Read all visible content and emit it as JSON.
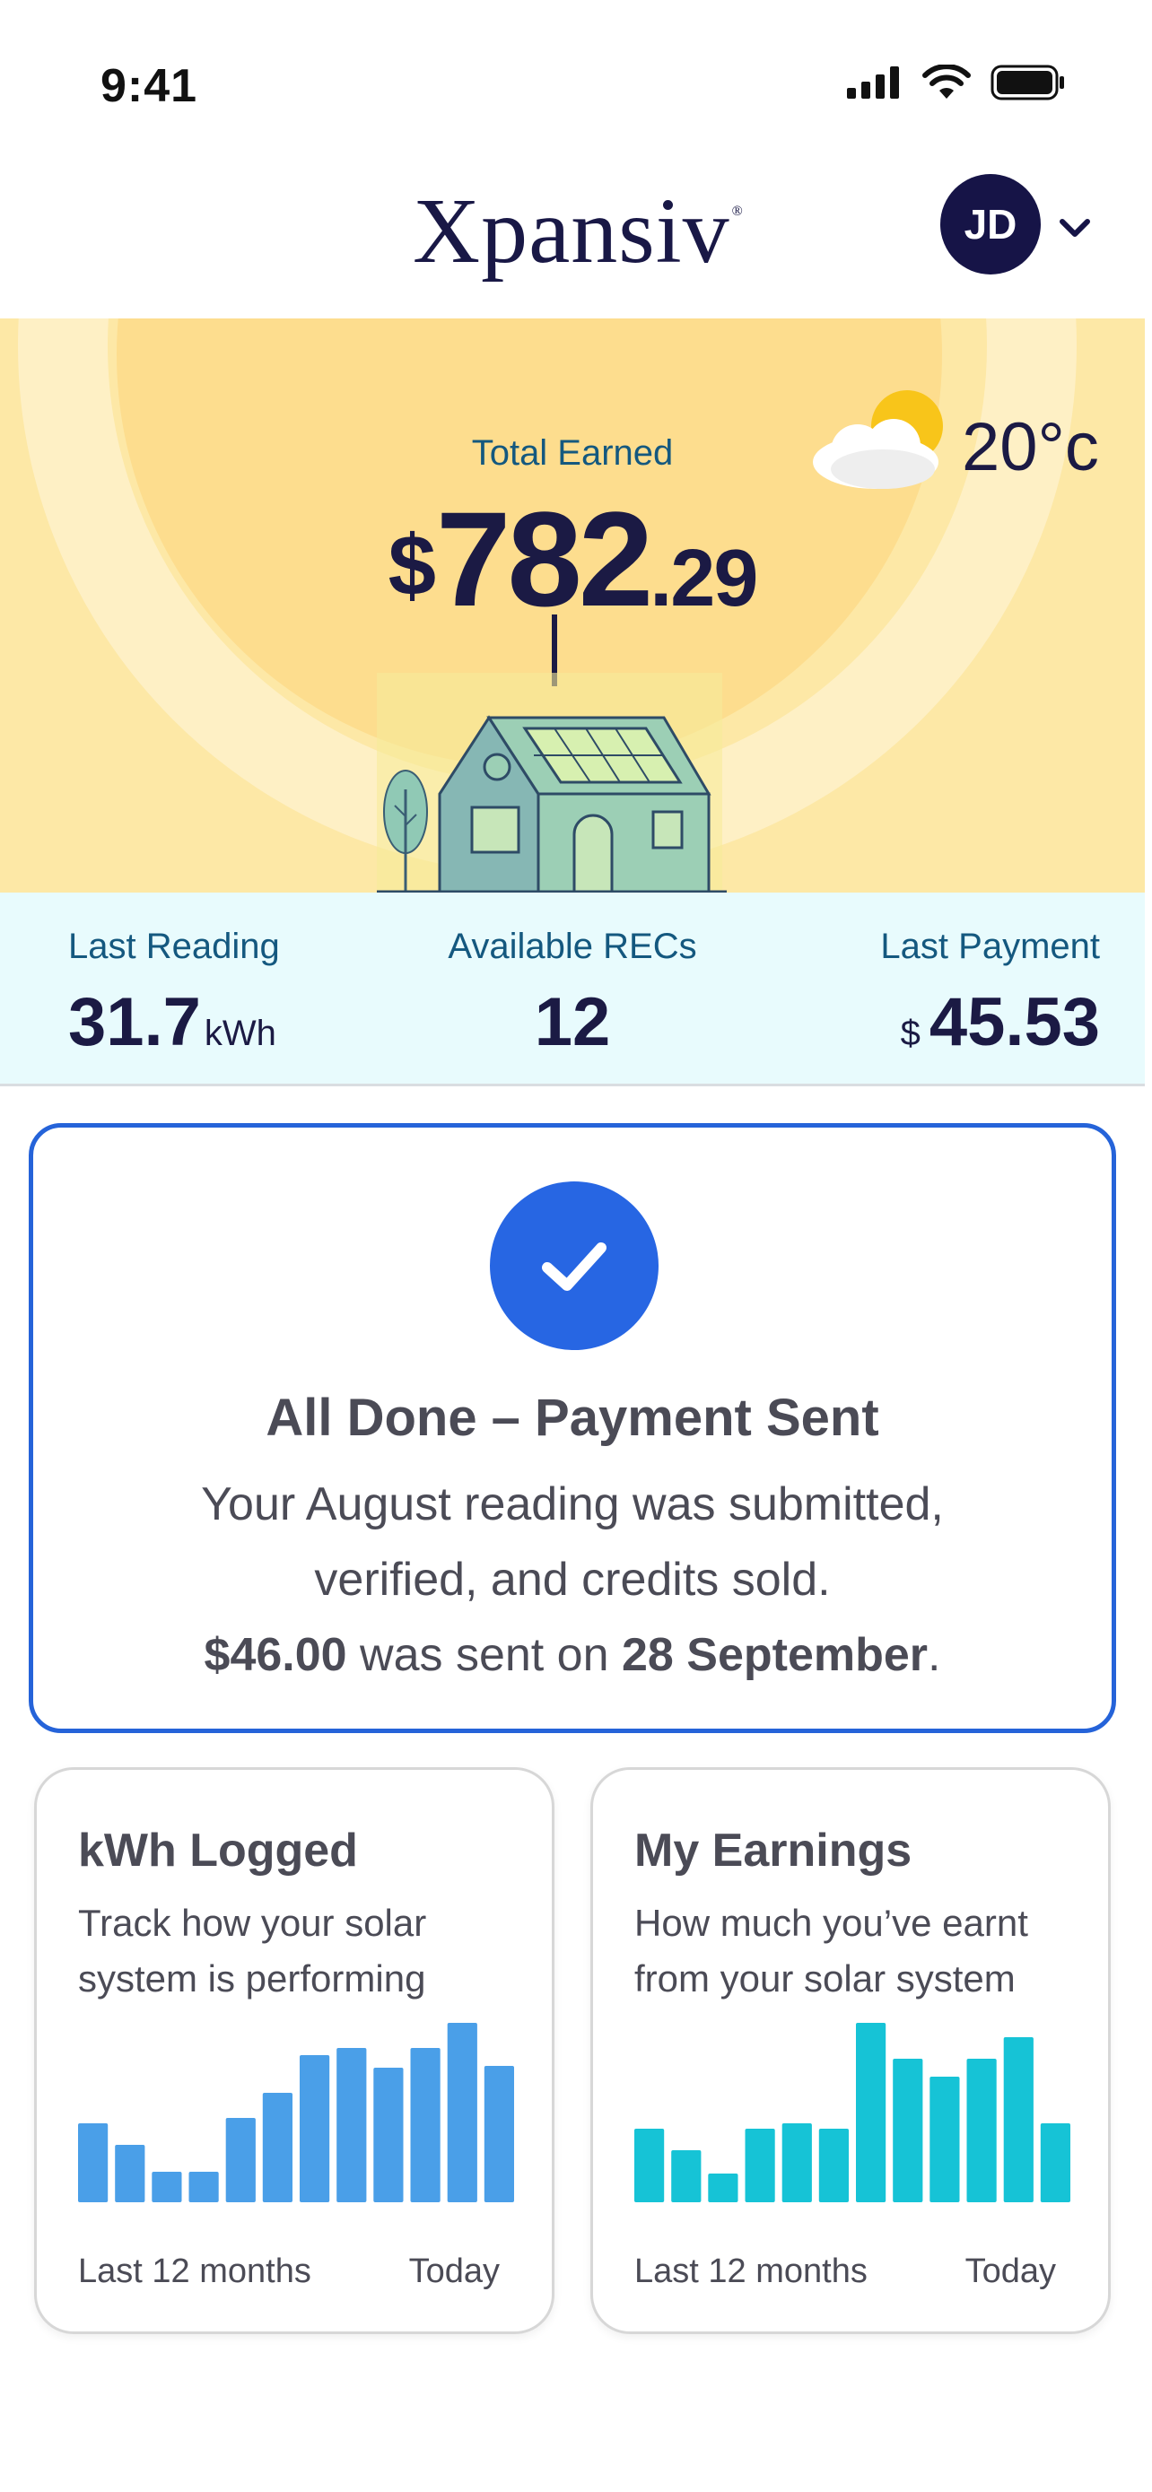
{
  "status_bar": {
    "time": "9:41"
  },
  "header": {
    "logo": "Xpansiv",
    "logo_mark": "®",
    "avatar_initials": "JD"
  },
  "hero": {
    "total_label": "Total Earned",
    "currency": "$",
    "amount_main": "782",
    "amount_cents": ".29",
    "temperature": "20°c"
  },
  "stats": {
    "last_reading_label": "Last Reading",
    "last_reading_value": "31.7",
    "last_reading_unit": "kWh",
    "recs_label": "Available RECs",
    "recs_value": "12",
    "last_payment_label": "Last Payment",
    "last_payment_currency": "$",
    "last_payment_value": "45.53"
  },
  "payment_card": {
    "title": "All Done – Payment Sent",
    "line1": "Your August reading was submitted,",
    "line2": "verified, and credits sold.",
    "amount": "$46.00",
    "sent_text": " was sent on ",
    "date": "28 September",
    "period": "."
  },
  "kwh_card": {
    "title": "kWh Logged",
    "subtitle_line1": "Track how your solar",
    "subtitle_line2": "system is performing",
    "footer_left": "Last 12 months",
    "footer_right": "Today",
    "color": "#4a9fe8"
  },
  "earnings_card": {
    "title": "My Earnings",
    "subtitle_line1": "How much you’ve earnt",
    "subtitle_line2": "from your solar system",
    "footer_left": "Last 12 months",
    "footer_right": "Today",
    "color": "#16c3d6"
  },
  "chart_data": [
    {
      "type": "bar",
      "name": "kWh Logged",
      "values": [
        0.44,
        0.32,
        0.17,
        0.17,
        0.47,
        0.61,
        0.82,
        0.86,
        0.75,
        0.86,
        1.0,
        0.76
      ]
    },
    {
      "type": "bar",
      "name": "My Earnings",
      "values": [
        0.41,
        0.29,
        0.16,
        0.41,
        0.44,
        0.41,
        1.0,
        0.8,
        0.7,
        0.8,
        0.92,
        0.44
      ]
    }
  ]
}
